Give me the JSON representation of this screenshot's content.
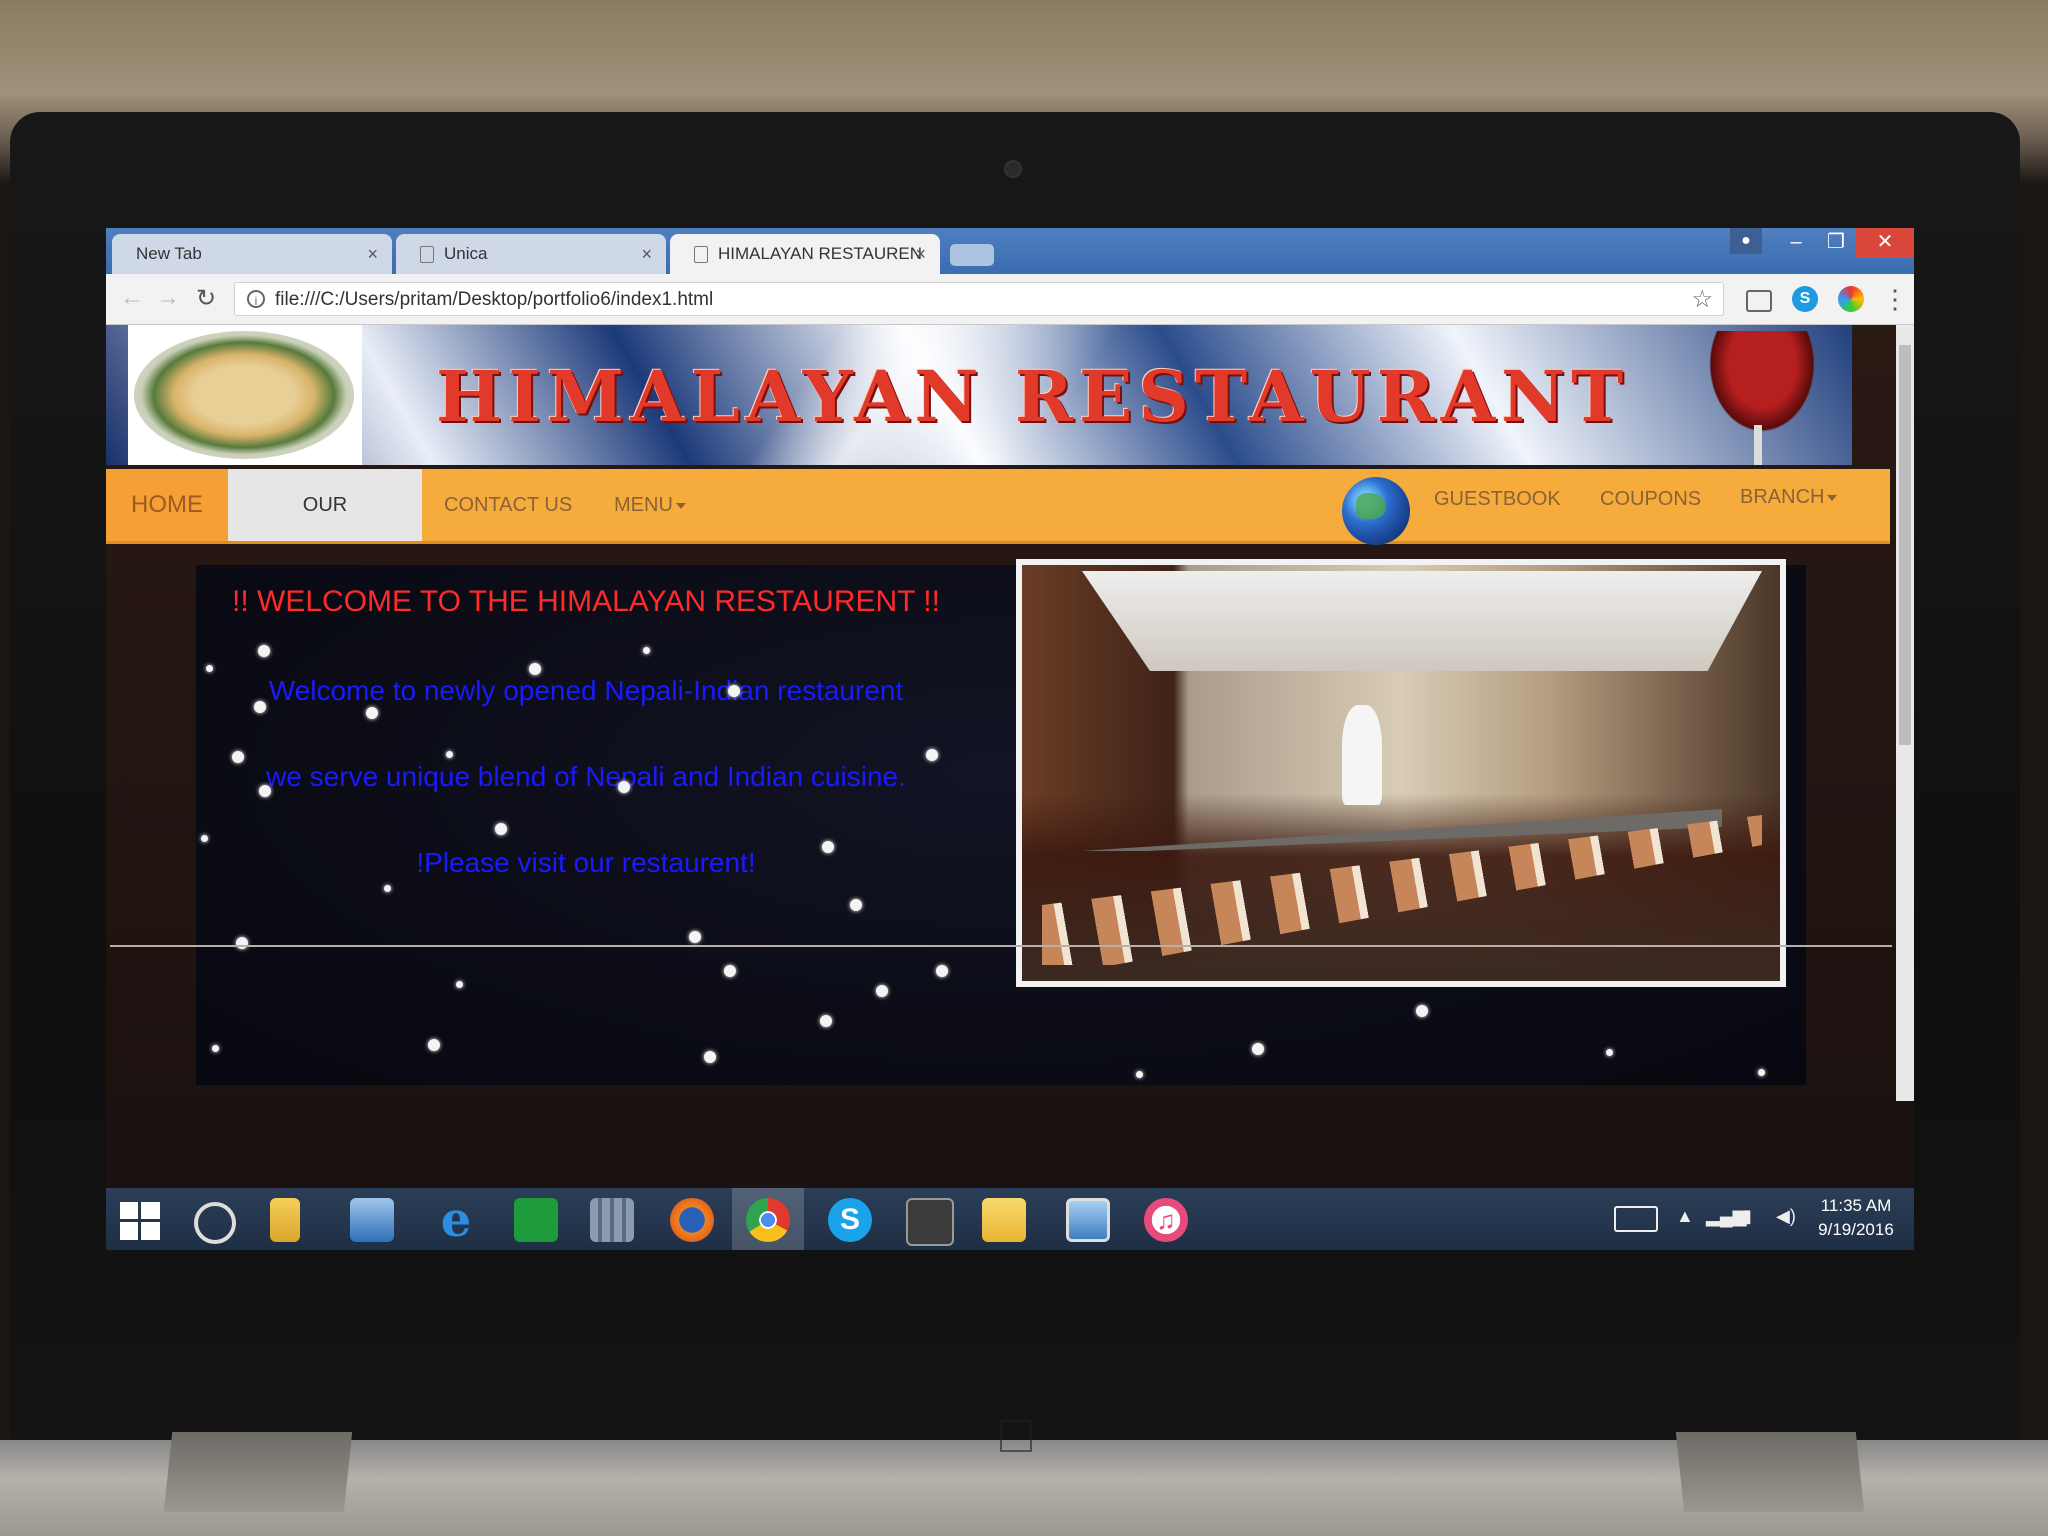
{
  "browser": {
    "tabs": [
      {
        "label": "New Tab"
      },
      {
        "label": "Unica"
      },
      {
        "label": "HIMALAYAN RESTAUREN"
      }
    ],
    "url": "file:///C:/Users/pritam/Desktop/portfolio6/index1.html"
  },
  "site": {
    "title": "HIMALAYAN RESTAURANT",
    "nav": {
      "home": "HOME",
      "our_location": "OUR LOCATION",
      "contact_us": "CONTACT US",
      "menu": "MENU",
      "guestbook": "GUESTBOOK",
      "coupons": "COUPONS",
      "branch": "BRANCH"
    },
    "hero": {
      "heading": "!! WELCOME TO THE HIMALAYAN RESTAURENT !!",
      "line1": "Welcome to newly opened Nepali-Indian restaurent",
      "line2": "we serve unique blend of Nepali and Indian cuisine.",
      "line3": "!Please visit our restaurent!"
    }
  },
  "taskbar": {
    "time": "11:35 AM",
    "date": "9/19/2016"
  },
  "colors": {
    "nav_orange": "#f6ac3c",
    "heading_red": "#ff2a2a",
    "text_blue": "#1a1aff",
    "title_red": "#e23a2a"
  }
}
